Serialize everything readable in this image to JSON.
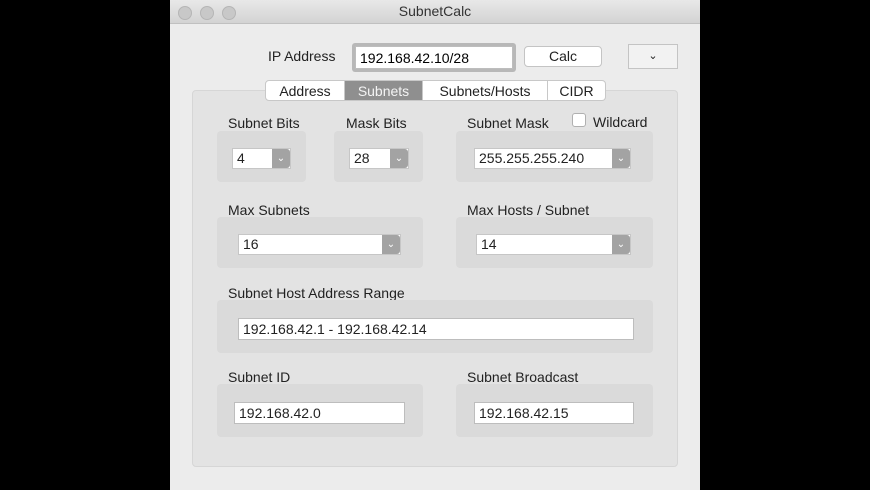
{
  "window": {
    "title": "SubnetCalc"
  },
  "ip": {
    "label": "IP Address",
    "value": "192.168.42.10/28",
    "calc_label": "Calc",
    "menu_icon": "chevron-down"
  },
  "tabs": [
    {
      "label": "Address"
    },
    {
      "label": "Subnets",
      "selected": true
    },
    {
      "label": "Subnets/Hosts"
    },
    {
      "label": "CIDR"
    }
  ],
  "subnets": {
    "subnet_bits": {
      "label": "Subnet Bits",
      "value": "4"
    },
    "mask_bits": {
      "label": "Mask Bits",
      "value": "28"
    },
    "subnet_mask": {
      "label": "Subnet Mask",
      "value": "255.255.255.240"
    },
    "wildcard": {
      "label": "Wildcard",
      "checked": false
    },
    "max_subnets": {
      "label": "Max Subnets",
      "value": "16"
    },
    "max_hosts": {
      "label": "Max Hosts / Subnet",
      "value": "14"
    },
    "range": {
      "label": "Subnet Host Address Range",
      "value": "192.168.42.1 - 192.168.42.14"
    },
    "subnet_id": {
      "label": "Subnet ID",
      "value": "192.168.42.0"
    },
    "broadcast": {
      "label": "Subnet Broadcast",
      "value": "192.168.42.15"
    }
  }
}
